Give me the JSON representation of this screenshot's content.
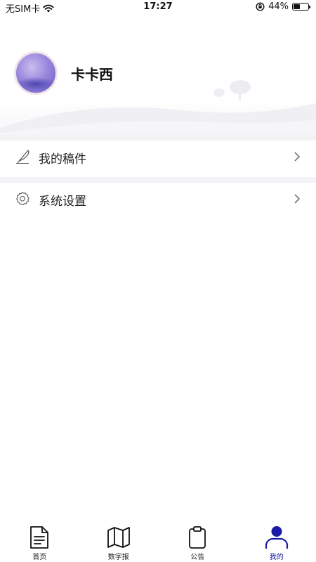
{
  "status_bar": {
    "carrier": "无SIM卡",
    "time": "17:27",
    "battery": "44%",
    "battery_level": 0.44
  },
  "profile": {
    "user_name": "卡卡西"
  },
  "menu": [
    {
      "label": "我的稿件",
      "icon": "quill-pen-icon"
    },
    {
      "label": "系统设置",
      "icon": "gear-icon"
    }
  ],
  "tabs": [
    {
      "label": "首页",
      "icon": "document-icon",
      "active": false
    },
    {
      "label": "数字报",
      "icon": "map-icon",
      "active": false
    },
    {
      "label": "公告",
      "icon": "clipboard-icon",
      "active": false
    },
    {
      "label": "我的",
      "icon": "user-icon",
      "active": true
    }
  ],
  "colors": {
    "accent": "#1a1aa6",
    "text": "#222222",
    "divider": "#f3f3f6"
  }
}
